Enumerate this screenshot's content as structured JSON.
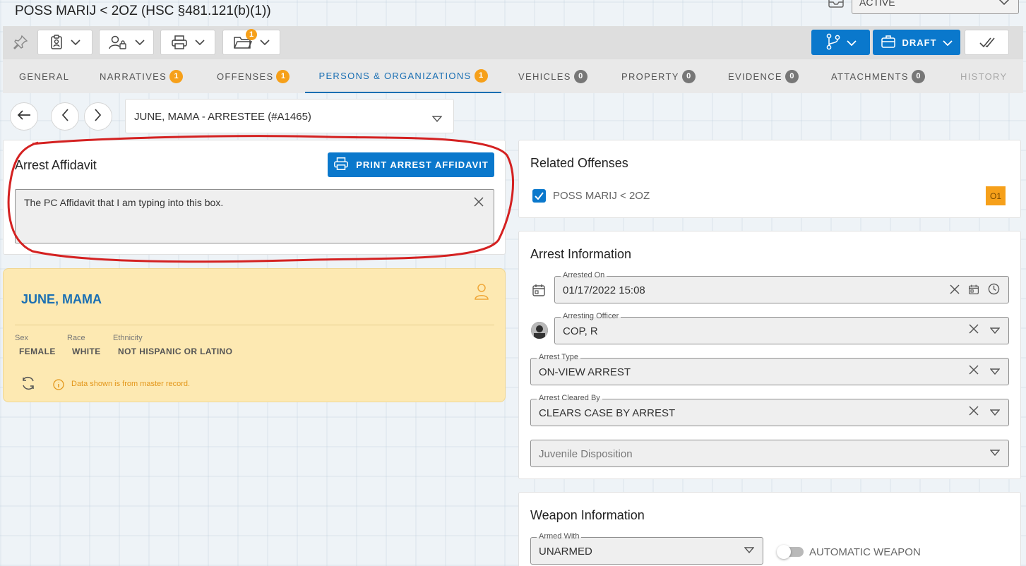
{
  "header": {
    "title": "POSS MARIJ < 2OZ (HSC §481.121(b)(1))",
    "status": "ACTIVE"
  },
  "toolbar": {
    "folder_badge": "1",
    "draft_label": "DRAFT"
  },
  "tabs": [
    {
      "label": "GENERAL",
      "count": null
    },
    {
      "label": "NARRATIVES",
      "count": "1"
    },
    {
      "label": "OFFENSES",
      "count": "1"
    },
    {
      "label": "PERSONS & ORGANIZATIONS",
      "count": "1"
    },
    {
      "label": "VEHICLES",
      "count": "0"
    },
    {
      "label": "PROPERTY",
      "count": "0"
    },
    {
      "label": "EVIDENCE",
      "count": "0"
    },
    {
      "label": "ATTACHMENTS",
      "count": "0"
    },
    {
      "label": "HISTORY",
      "count": null
    }
  ],
  "person_select": {
    "value": "JUNE, MAMA - ARRESTEE (#A1465)"
  },
  "affidavit": {
    "title": "Arrest Affidavit",
    "print_label": "PRINT ARREST AFFIDAVIT",
    "text": "The PC Affidavit that I am typing into this box."
  },
  "person": {
    "name": "JUNE, MAMA",
    "sex_label": "Sex",
    "sex": "FEMALE",
    "race_label": "Race",
    "race": "WHITE",
    "ethnicity_label": "Ethnicity",
    "ethnicity": "NOT HISPANIC OR LATINO",
    "note": "Data shown is from master record."
  },
  "related_offenses": {
    "title": "Related Offenses",
    "items": [
      {
        "label": "POSS MARIJ < 2OZ",
        "code": "O1",
        "checked": true
      }
    ]
  },
  "arrest_info": {
    "title": "Arrest Information",
    "arrested_on_label": "Arrested On",
    "arrested_on": "01/17/2022 15:08",
    "officer_label": "Arresting Officer",
    "officer": "COP, R",
    "type_label": "Arrest Type",
    "type": "ON-VIEW ARREST",
    "cleared_label": "Arrest Cleared By",
    "cleared": "CLEARS CASE BY ARREST",
    "juvenile_placeholder": "Juvenile Disposition"
  },
  "weapon_info": {
    "title": "Weapon Information",
    "armed_label": "Armed With",
    "armed": "UNARMED",
    "automatic_label": "AUTOMATIC WEAPON",
    "automatic": false
  },
  "colors": {
    "primary": "#0a78cc",
    "accent_orange": "#f6a01a",
    "person_card_bg": "#fde9b2",
    "highlight_red": "#d42121"
  }
}
